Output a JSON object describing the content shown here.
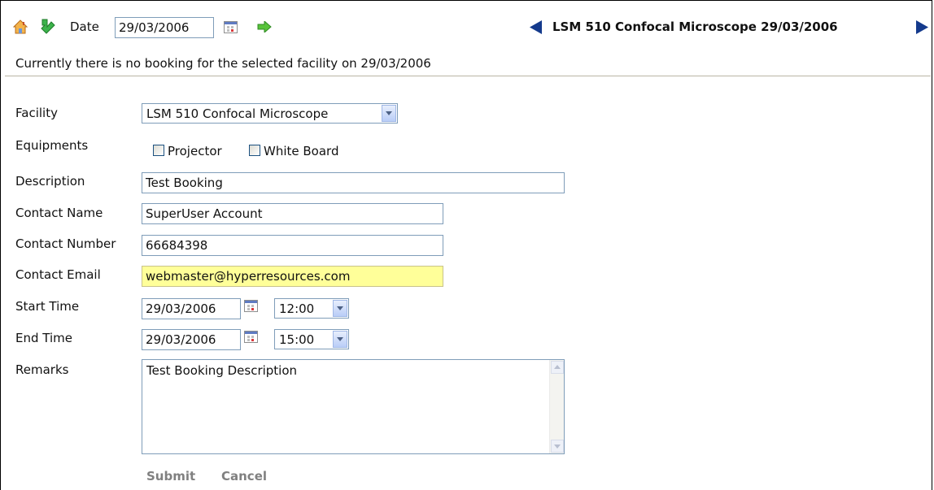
{
  "toolbar": {
    "date_label": "Date",
    "date_value": "29/03/2006",
    "nav_title": "LSM 510 Confocal Microscope  29/03/2006"
  },
  "status_message": "Currently there is no booking for the selected facility on 29/03/2006",
  "form": {
    "facility": {
      "label": "Facility",
      "value": "LSM 510 Confocal Microscope"
    },
    "equipments": {
      "label": "Equipments",
      "options": [
        {
          "label": "Projector",
          "checked": false
        },
        {
          "label": "White Board",
          "checked": false
        }
      ]
    },
    "description": {
      "label": "Description",
      "value": "Test Booking"
    },
    "contact_name": {
      "label": "Contact Name",
      "value": "SuperUser Account"
    },
    "contact_number": {
      "label": "Contact Number",
      "value": "66684398"
    },
    "contact_email": {
      "label": "Contact Email",
      "value": "webmaster@hyperresources.com"
    },
    "start_time": {
      "label": "Start Time",
      "date": "29/03/2006",
      "time": "12:00"
    },
    "end_time": {
      "label": "End Time",
      "date": "29/03/2006",
      "time": "15:00"
    },
    "remarks": {
      "label": "Remarks",
      "value": "Test Booking Description"
    },
    "submit_label": "Submit",
    "cancel_label": "Cancel"
  },
  "colors": {
    "highlight_field": "#ffff99",
    "input_border": "#7f9db9",
    "divider": "#b9b5a4",
    "action_text": "#808080"
  }
}
